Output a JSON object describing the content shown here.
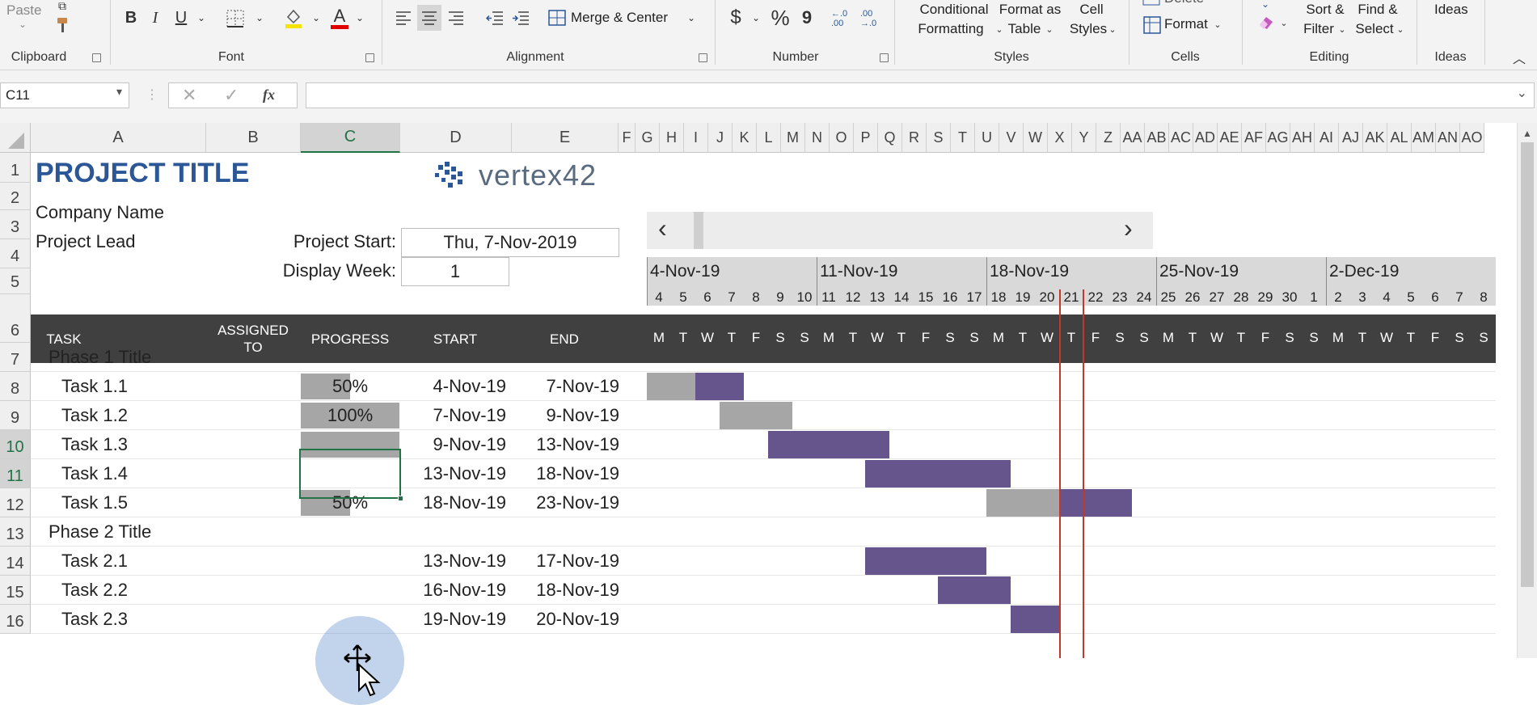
{
  "ribbon": {
    "clipboard": {
      "label": "Clipboard",
      "paste": "Paste"
    },
    "font": {
      "label": "Font",
      "bold": "B",
      "italic": "I",
      "underline": "U",
      "font_color": "A"
    },
    "alignment": {
      "label": "Alignment",
      "merge": "Merge & Center"
    },
    "number": {
      "label": "Number",
      "currency": "$",
      "percent": "%",
      "comma": "9",
      "inc_decimal": "←.0 .00",
      "dec_decimal": ".00 →.0"
    },
    "styles": {
      "label": "Styles",
      "conditional": [
        "Conditional",
        "Formatting"
      ],
      "format_table": [
        "Format as",
        "Table"
      ],
      "cell_styles": [
        "Cell",
        "Styles"
      ]
    },
    "cells": {
      "label": "Cells",
      "delete": "Delete",
      "format": "Format"
    },
    "editing": {
      "label": "Editing",
      "sort": [
        "Sort &",
        "Filter"
      ],
      "find": [
        "Find &",
        "Select"
      ]
    },
    "ideas": {
      "label": "Ideas",
      "button": "Ideas"
    }
  },
  "formula_bar": {
    "name_box": "C11",
    "fx": "fx",
    "value": ""
  },
  "columns": [
    "A",
    "B",
    "C",
    "D",
    "E",
    "F",
    "G",
    "H",
    "I",
    "J",
    "K",
    "L",
    "M",
    "N",
    "O",
    "P",
    "Q",
    "R",
    "S",
    "T",
    "U",
    "V",
    "W",
    "X",
    "Y",
    "Z",
    "AA",
    "AB",
    "AC",
    "AD",
    "AE",
    "AF",
    "AG",
    "AH",
    "AI",
    "AJ",
    "AK",
    "AL",
    "AM",
    "AN",
    "AO"
  ],
  "rows": [
    "1",
    "2",
    "3",
    "4",
    "5",
    "6",
    "7",
    "8",
    "9",
    "10",
    "11",
    "12",
    "13",
    "14",
    "15",
    "16"
  ],
  "sheet": {
    "project_title": "PROJECT TITLE",
    "company": "Company Name",
    "lead": "Project Lead",
    "start_label": "Project Start:",
    "start_value": "Thu, 7-Nov-2019",
    "week_label": "Display Week:",
    "week_value": "1",
    "logo": "vertex42",
    "scroll_left": "‹",
    "scroll_right": "›"
  },
  "table_header": {
    "task": "TASK",
    "assigned": [
      "ASSIGNED",
      "TO"
    ],
    "progress": "PROGRESS",
    "start": "START",
    "end": "END"
  },
  "weeks": [
    "4-Nov-19",
    "11-Nov-19",
    "18-Nov-19",
    "25-Nov-19",
    "2-Dec-19"
  ],
  "day_numbers": [
    "4",
    "5",
    "6",
    "7",
    "8",
    "9",
    "10",
    "11",
    "12",
    "13",
    "14",
    "15",
    "16",
    "17",
    "18",
    "19",
    "20",
    "21",
    "22",
    "23",
    "24",
    "25",
    "26",
    "27",
    "28",
    "29",
    "30",
    "1",
    "2",
    "3",
    "4",
    "5",
    "6",
    "7",
    "8"
  ],
  "day_letters": [
    "M",
    "T",
    "W",
    "T",
    "F",
    "S",
    "S",
    "M",
    "T",
    "W",
    "T",
    "F",
    "S",
    "S",
    "M",
    "T",
    "W",
    "T",
    "F",
    "S",
    "S",
    "M",
    "T",
    "W",
    "T",
    "F",
    "S",
    "S",
    "M",
    "T",
    "W",
    "T",
    "F",
    "S",
    "S"
  ],
  "tasks": [
    {
      "name": "Phase 1 Title",
      "phase": true
    },
    {
      "name": "Task 1.1",
      "progress": "50%",
      "progress_value": 0.5,
      "start": "4-Nov-19",
      "end": "7-Nov-19",
      "bar_start": 0,
      "bar_days": 4
    },
    {
      "name": "Task 1.2",
      "progress": "100%",
      "progress_value": 1.0,
      "start": "7-Nov-19",
      "end": "9-Nov-19",
      "bar_start": 3,
      "bar_days": 3
    },
    {
      "name": "Task 1.3",
      "progress": "",
      "progress_value": 0,
      "start": "9-Nov-19",
      "end": "13-Nov-19",
      "bar_start": 5,
      "bar_days": 5
    },
    {
      "name": "Task 1.4",
      "progress": "",
      "progress_value": 0,
      "start": "13-Nov-19",
      "end": "18-Nov-19",
      "bar_start": 9,
      "bar_days": 6
    },
    {
      "name": "Task 1.5",
      "progress": "50%",
      "progress_value": 0.5,
      "start": "18-Nov-19",
      "end": "23-Nov-19",
      "bar_start": 14,
      "bar_days": 6
    },
    {
      "name": "Phase 2 Title",
      "phase": true
    },
    {
      "name": "Task 2.1",
      "progress": "",
      "progress_value": 0,
      "start": "13-Nov-19",
      "end": "17-Nov-19",
      "bar_start": 9,
      "bar_days": 5
    },
    {
      "name": "Task 2.2",
      "progress": "",
      "progress_value": 0,
      "start": "16-Nov-19",
      "end": "18-Nov-19",
      "bar_start": 12,
      "bar_days": 3
    },
    {
      "name": "Task 2.3",
      "progress": "",
      "progress_value": 0,
      "start": "19-Nov-19",
      "end": "20-Nov-19",
      "bar_start": 15,
      "bar_days": 2
    }
  ],
  "today_index": 17,
  "colors": {
    "accent": "#2b5797",
    "bar_done": "#a6a6a6",
    "bar_todo": "#66558c",
    "header_dark": "#404040",
    "today_line": "#c0392b",
    "selection": "#217346"
  }
}
